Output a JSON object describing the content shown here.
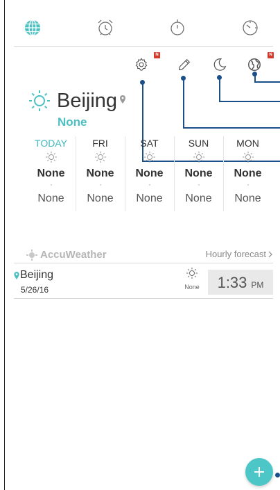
{
  "tabs": [
    {
      "name": "world-clock",
      "icon": "globe-icon"
    },
    {
      "name": "alarm",
      "icon": "alarm-clock-icon"
    },
    {
      "name": "stopwatch",
      "icon": "stopwatch-icon"
    },
    {
      "name": "timer",
      "icon": "timer-icon"
    }
  ],
  "toolbar": {
    "settings_icon": "gear-icon",
    "settings_badge": "N",
    "edit_icon": "pencil-icon",
    "night_icon": "moon-icon",
    "globe_icon": "globe-icon",
    "globe_badge": "N"
  },
  "current": {
    "city": "Beijing",
    "temp": "None",
    "icon": "sun-icon"
  },
  "forecast": [
    {
      "day": "TODAY",
      "high": "None",
      "low": "None",
      "is_today": true
    },
    {
      "day": "FRI",
      "high": "None",
      "low": "None"
    },
    {
      "day": "SAT",
      "high": "None",
      "low": "None"
    },
    {
      "day": "SUN",
      "high": "None",
      "low": "None"
    },
    {
      "day": "MON",
      "high": "None",
      "low": "None"
    }
  ],
  "accuweather": {
    "brand": "AccuWeather",
    "hourly_label": "Hourly forecast"
  },
  "world_clock": {
    "city": "Beijing",
    "date": "5/26/16",
    "weather": "None",
    "time": "1:33",
    "ampm": "PM"
  },
  "colors": {
    "accent": "#4ac0c3",
    "callout": "#1b4f8a",
    "badge": "#d43b2c"
  }
}
